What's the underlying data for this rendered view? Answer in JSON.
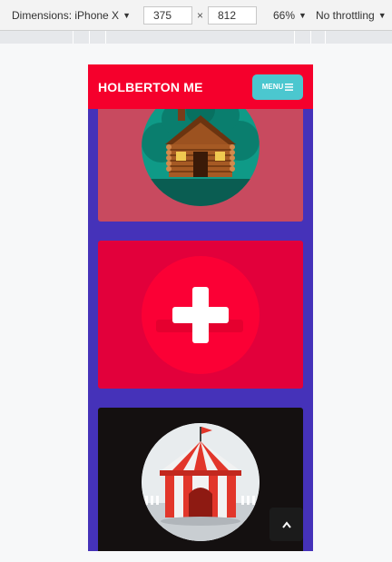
{
  "devtools": {
    "device_label": "Dimensions: iPhone X",
    "width": "375",
    "times": "×",
    "height": "812",
    "zoom": "66%",
    "throttle": "No throttling"
  },
  "site": {
    "brand": "HOLBERTON ME",
    "menu_label": "MENU",
    "menu_icon": "hamburger-icon"
  },
  "cards": [
    {
      "name": "cabin",
      "bg": "#c84a5f",
      "icon": "log-cabin-illustration"
    },
    {
      "name": "add",
      "bg": "#e2003b",
      "icon": "plus-icon"
    },
    {
      "name": "circus",
      "bg": "#141010",
      "icon": "circus-tent-illustration"
    }
  ],
  "scroll_top_icon": "chevron-up-icon",
  "colors": {
    "header": "#f5002c",
    "page_bg": "#4532b9",
    "menu_button": "#4bc7cf"
  }
}
